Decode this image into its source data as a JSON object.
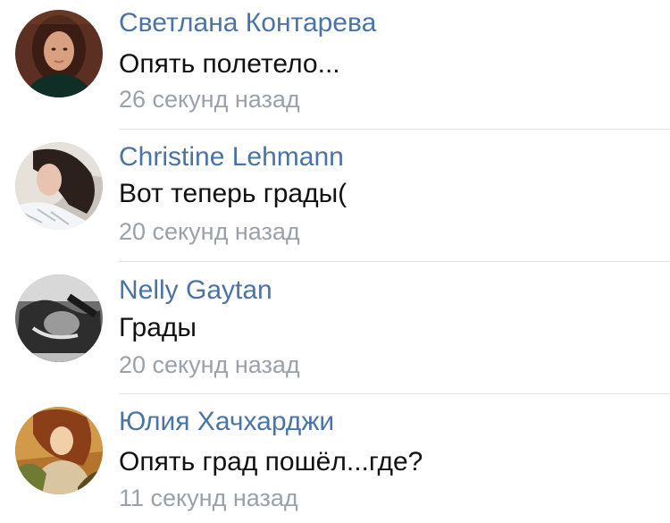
{
  "comments": [
    {
      "author": "Светлана Контарева",
      "text": "Опять полетело...",
      "time": "26 секунд назад",
      "avatar_icon": "user-photo-1"
    },
    {
      "author": "Christine Lehmann",
      "text": "Вот теперь грады(",
      "time": "20 секунд назад",
      "avatar_icon": "user-photo-2"
    },
    {
      "author": "Nelly Gaytan",
      "text": "Грады",
      "time": "20 секунд назад",
      "avatar_icon": "user-photo-3"
    },
    {
      "author": "Юлия Хачхарджи",
      "text": "Опять град пошёл...где?",
      "time": "11 секунд назад",
      "avatar_icon": "user-photo-4"
    }
  ],
  "colors": {
    "author": "#4a74a6",
    "text": "#111111",
    "time": "#9aa1a8",
    "divider": "#dcdfe3"
  }
}
